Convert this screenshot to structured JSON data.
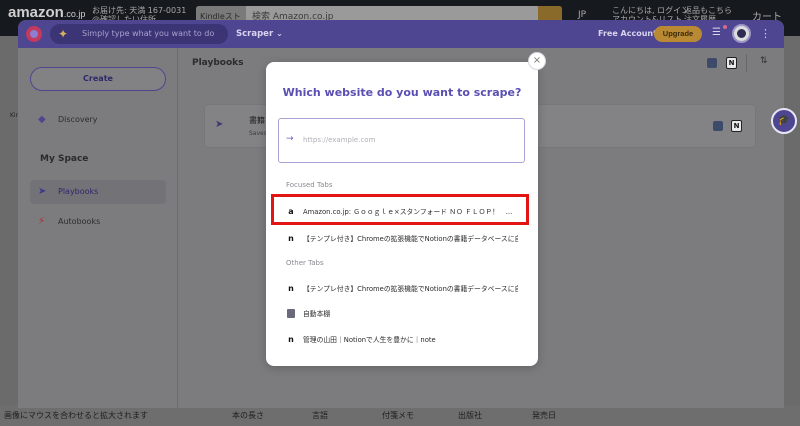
{
  "amazon": {
    "logo": "amazon",
    "logo_suffix": ".co.jp",
    "deliver_line1": "お届け先: 天満 167-0031",
    "deliver_line2": "@確認したい住所",
    "search_category": "Kindleストア ▾",
    "search_query": "検索 Amazon.co.jp",
    "lang": "JP",
    "account_line1": "こんにちは, ログイン",
    "account_line2": "アカウント&リスト",
    "orders_line1": "返品もこちら",
    "orders_line2": "注文履歴",
    "cart": "カート",
    "left_k": "Kin",
    "bottom_hint": "画像にマウスを合わせると拡大されます",
    "bottom_cols": [
      "本の長さ",
      "言語",
      "付箋メモ",
      "出版社",
      "発売日"
    ]
  },
  "header": {
    "ask_placeholder": "Simply type what you want to do",
    "mode_label": "Scraper",
    "free_account": "Free Account",
    "upgrade_label": "Upgrade"
  },
  "sidebar": {
    "create_label": "Create",
    "discovery_label": "Discovery",
    "my_space_heading": "My Space",
    "playbooks_label": "Playbooks",
    "autobooks_label": "Autobooks"
  },
  "main": {
    "title": "Playbooks",
    "card_title": "書籍",
    "card_sub": "Saves"
  },
  "modal": {
    "title": "Which website do you want to scrape?",
    "url_placeholder": "https://example.com",
    "focused_heading": "Focused Tabs",
    "focused_tabs": [
      {
        "favicon": "a",
        "label": "Amazon.co.jp: Ｇｏｏｇｌｅ×スタンフォード ＮＯ ＦＬＯＰ！　..."
      },
      {
        "favicon": "n",
        "label": "【テンプレ付き】Chromeの拡張機能でNotionの書籍データベースに自..."
      }
    ],
    "other_heading": "Other Tabs",
    "other_tabs": [
      {
        "favicon": "n",
        "label": "【テンプレ付き】Chromeの拡張機能でNotionの書籍データベースに自..."
      },
      {
        "favicon": "doc",
        "label": "自動本棚"
      },
      {
        "favicon": "n",
        "label": "管理の山田｜Notionで人生を豊かに｜note"
      }
    ]
  },
  "icons": {
    "notion_glyph": "N",
    "close_glyph": "×",
    "arrow_glyph": "→",
    "kebab_glyph": "⋮",
    "chevron_glyph": "⌄",
    "sparkle_glyph": "✦"
  },
  "colors": {
    "brand_purple": "#5a4fb2",
    "upgrade_orange": "#e8a23b",
    "highlight_red": "#e21414"
  }
}
